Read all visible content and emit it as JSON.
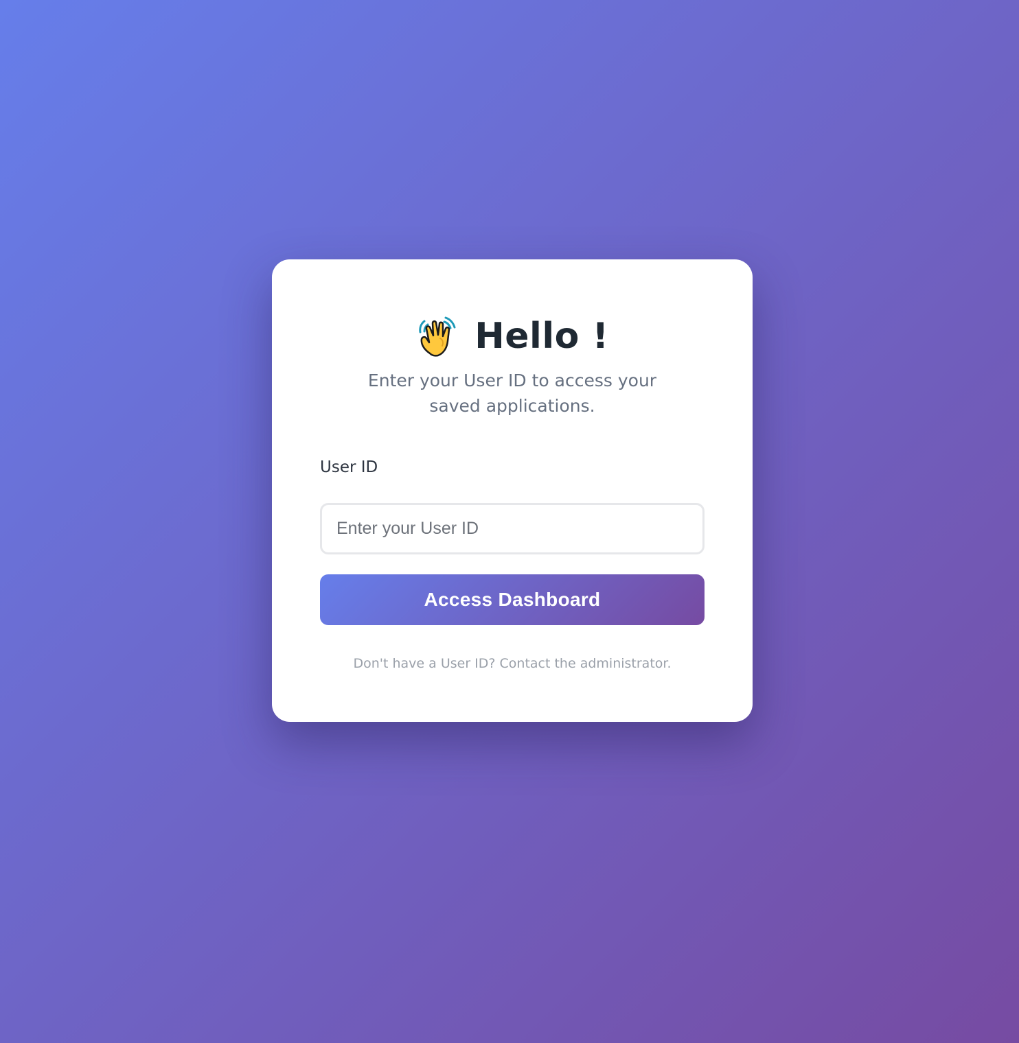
{
  "login": {
    "title": "Hello !",
    "title_icon": "waving-hand-icon",
    "subtitle": "Enter your User ID to access your saved applications.",
    "user_id_label": "User ID",
    "user_id_placeholder": "Enter your User ID",
    "user_id_value": "",
    "submit_label": "Access Dashboard",
    "footer_note": "Don't have a User ID? Contact the administrator."
  },
  "colors": {
    "gradient_start": "#667eea",
    "gradient_end": "#764ba2",
    "card_background": "#ffffff",
    "title_text": "#1f2933",
    "muted_text": "#667080"
  }
}
